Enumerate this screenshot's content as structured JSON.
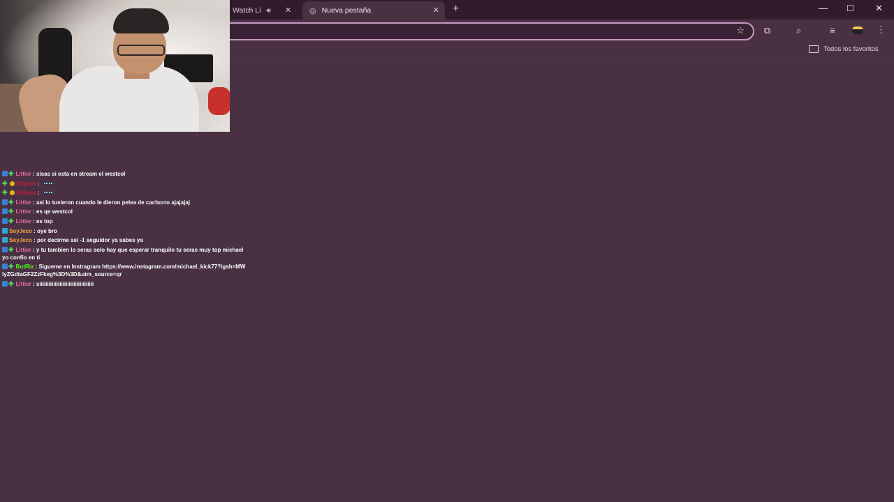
{
  "browser": {
    "tabs": [
      {
        "title": "Watch Li",
        "audio": "speaker-icon"
      },
      {
        "title": "Nueva pestaña",
        "active": true
      }
    ],
    "new_tab_symbol": "+",
    "window_controls": {
      "minimize": "—",
      "maximize": "☐",
      "close": "✕"
    },
    "omnibox_value": "",
    "bookmarks": {
      "all_bookmarks_label": "Todos los favoritos"
    }
  },
  "chat": {
    "messages": [
      {
        "badges": [
          "mod",
          "sub"
        ],
        "user": "Littier",
        "user_color": "#e86b9b",
        "text": "sisas si esta en stream el westcol"
      },
      {
        "badges": [
          "sub",
          "gift"
        ],
        "user": "Ellipsis",
        "user_color": "#c0203a",
        "text": "",
        "emote": true
      },
      {
        "badges": [
          "sub",
          "gift"
        ],
        "user": "Ellipsis",
        "user_color": "#c0203a",
        "text": "",
        "emote": true
      },
      {
        "badges": [
          "mod",
          "sub"
        ],
        "user": "Littier",
        "user_color": "#e86b9b",
        "text": "asi lo tuvieron cuando le dieron pelea de cachorro ajajajaj"
      },
      {
        "badges": [
          "mod",
          "sub"
        ],
        "user": "Littier",
        "user_color": "#e86b9b",
        "text": "es qe westcol"
      },
      {
        "badges": [
          "mod",
          "sub"
        ],
        "user": "Littier",
        "user_color": "#e86b9b",
        "text": "es top"
      },
      {
        "badges": [
          "mod2"
        ],
        "user": "SoyJeco",
        "user_color": "#f2a93b",
        "text": "oye bro"
      },
      {
        "badges": [
          "mod2"
        ],
        "user": "SoyJeco",
        "user_color": "#f2a93b",
        "text": "por decirme asi -1 seguidor ya sabes ya"
      },
      {
        "badges": [
          "mod",
          "sub"
        ],
        "user": "Littier",
        "user_color": "#e86b9b",
        "text": "y tu tambien lo seras solo hay que esperar tranquilo tu seras muy top michael yo confio en ti"
      },
      {
        "badges": [
          "mod",
          "sub"
        ],
        "user": "BotRix",
        "user_color": "#53fc18",
        "text": "Sigueme en Instragram https://www.instagram.com/michael_kick77?igsh=MWlyZGdtaGF2ZzFkeg%3D%3D&utm_source=qr"
      },
      {
        "badges": [
          "mod",
          "sub"
        ],
        "user": "Littier",
        "user_color": "#e86b9b",
        "text": "siiiiiiiiiiiiiiiiiiiiiiiiiiiiiiiiiii"
      }
    ]
  },
  "colors": {
    "page_background": "#493143",
    "tabstrip": "#301c2b",
    "omnibox_border": "#c79ac1"
  }
}
